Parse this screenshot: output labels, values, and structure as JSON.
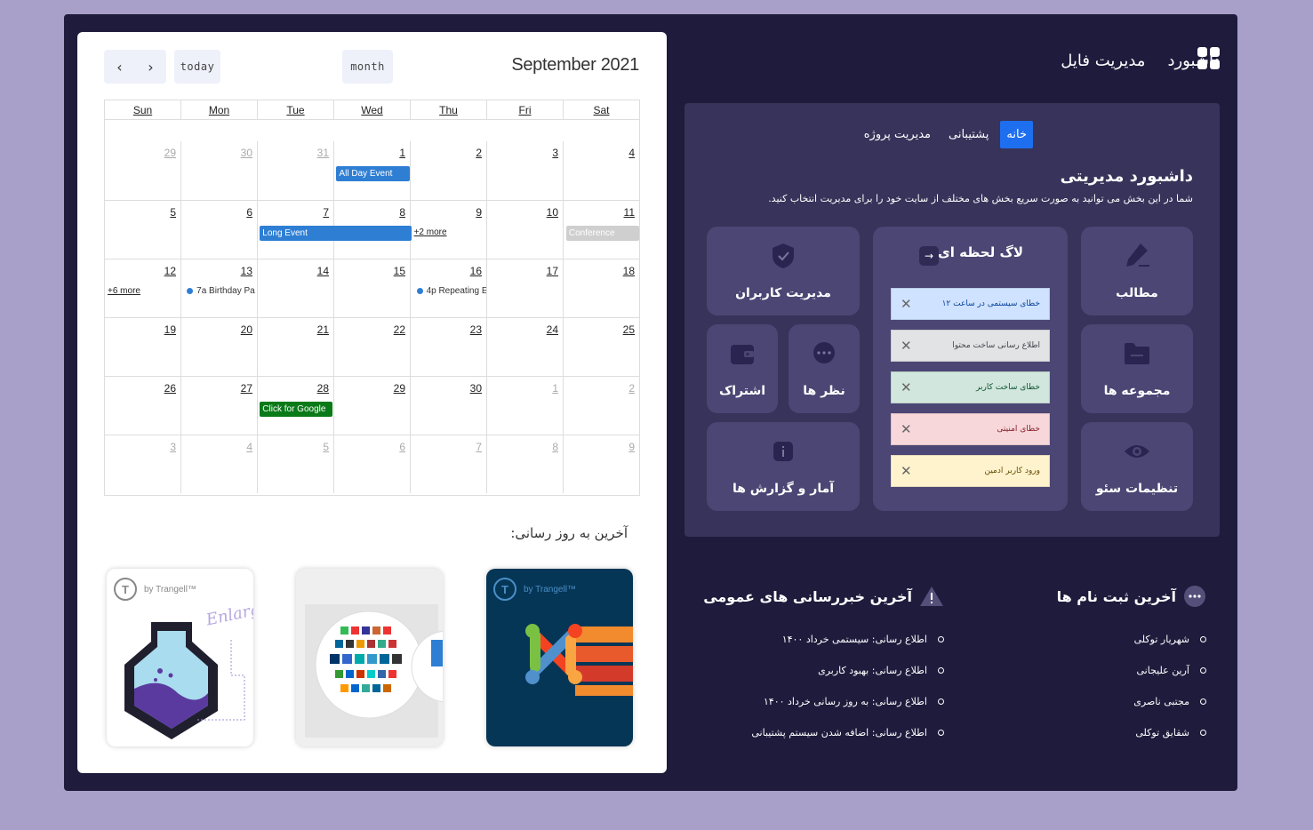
{
  "calendar": {
    "title": "September 2021",
    "today_label": "today",
    "month_label": "month",
    "prev_icon": "chevron-left-icon",
    "next_icon": "chevron-right-icon",
    "weekdays": [
      "Sun",
      "Mon",
      "Tue",
      "Wed",
      "Thu",
      "Fri",
      "Sat"
    ],
    "weeks": [
      [
        "29",
        "30",
        "31",
        "1",
        "2",
        "3",
        "4"
      ],
      [
        "5",
        "6",
        "7",
        "8",
        "9",
        "10",
        "11"
      ],
      [
        "12",
        "13",
        "14",
        "15",
        "16",
        "17",
        "18"
      ],
      [
        "19",
        "20",
        "21",
        "22",
        "23",
        "24",
        "25"
      ],
      [
        "26",
        "27",
        "28",
        "29",
        "30",
        "1",
        "2"
      ],
      [
        "3",
        "4",
        "5",
        "6",
        "7",
        "8",
        "9"
      ]
    ],
    "events": {
      "all_day": "All Day Event",
      "long_event": "Long Event",
      "more_thu": "+2 more",
      "conference": "Conference",
      "more_sun": "+6 more",
      "birthday": "7a Birthday Pa",
      "repeating": "4p Repeating E",
      "google": "Click for Google"
    },
    "colors": {
      "event_blue": "#2e7fd4",
      "event_grey": "#cfcfcf",
      "event_green": "#0a7a18"
    }
  },
  "updates": {
    "title": "آخرین به روز رسانی:",
    "brand": "by Trangell™",
    "items": [
      "Enlarge",
      "Icon set",
      "Joomla"
    ]
  },
  "nav": {
    "dashboard": "داشبورد",
    "file_manager": "مدیریت فایل",
    "icon": "grid-icon"
  },
  "dashboard": {
    "tabs": [
      "خانه",
      "پشتیبانی",
      "مدیریت پروژه"
    ],
    "title": "داشبورد مدیریتی",
    "subtitle": "شما در این بخش می توانید به صورت سریع بخش های مختلف از سایت خود را برای مدیریت انتخاب کنید.",
    "tiles": {
      "posts": "مطالب",
      "collections": "مجموعه ها",
      "seo": "تنظیمات سئو",
      "users": "مدیریت کاربران",
      "comments": "نظر ها",
      "subscription": "اشتراک",
      "stats": "آمار و گزارش ها"
    },
    "log": {
      "title": "لاگ لحظه ای",
      "items": [
        {
          "text": "خطای سیستمی در ساعت ۱۲",
          "bg": "#cfe2ff",
          "fg": "#084298"
        },
        {
          "text": "اطلاع رسانی ساخت محتوا",
          "bg": "#e2e3e5",
          "fg": "#41464b"
        },
        {
          "text": "خطای ساخت کاربر",
          "bg": "#d1e7dd",
          "fg": "#0f5132"
        },
        {
          "text": "خطای امنیتی",
          "bg": "#f8d7da",
          "fg": "#842029"
        },
        {
          "text": "ورود کاربر ادمین",
          "bg": "#fff3cd",
          "fg": "#664d03"
        }
      ]
    }
  },
  "registrations": {
    "title": "آخرین ثبت نام ها",
    "items": [
      "شهریار توکلی",
      "آرین علیجانی",
      "مجتبی ناصری",
      "شقایق توکلی"
    ]
  },
  "news": {
    "title": "آخرین خبررسانی های عمومی",
    "items": [
      "اطلاع رسانی: سیستمی خرداد ۱۴۰۰",
      "اطلاع رسانی: بهبود کاربری",
      "اطلاع رسانی: به روز رسانی خرداد ۱۴۰۰",
      "اطلاع رسانی: اضافه شدن سیستم پشتیبانی"
    ]
  }
}
